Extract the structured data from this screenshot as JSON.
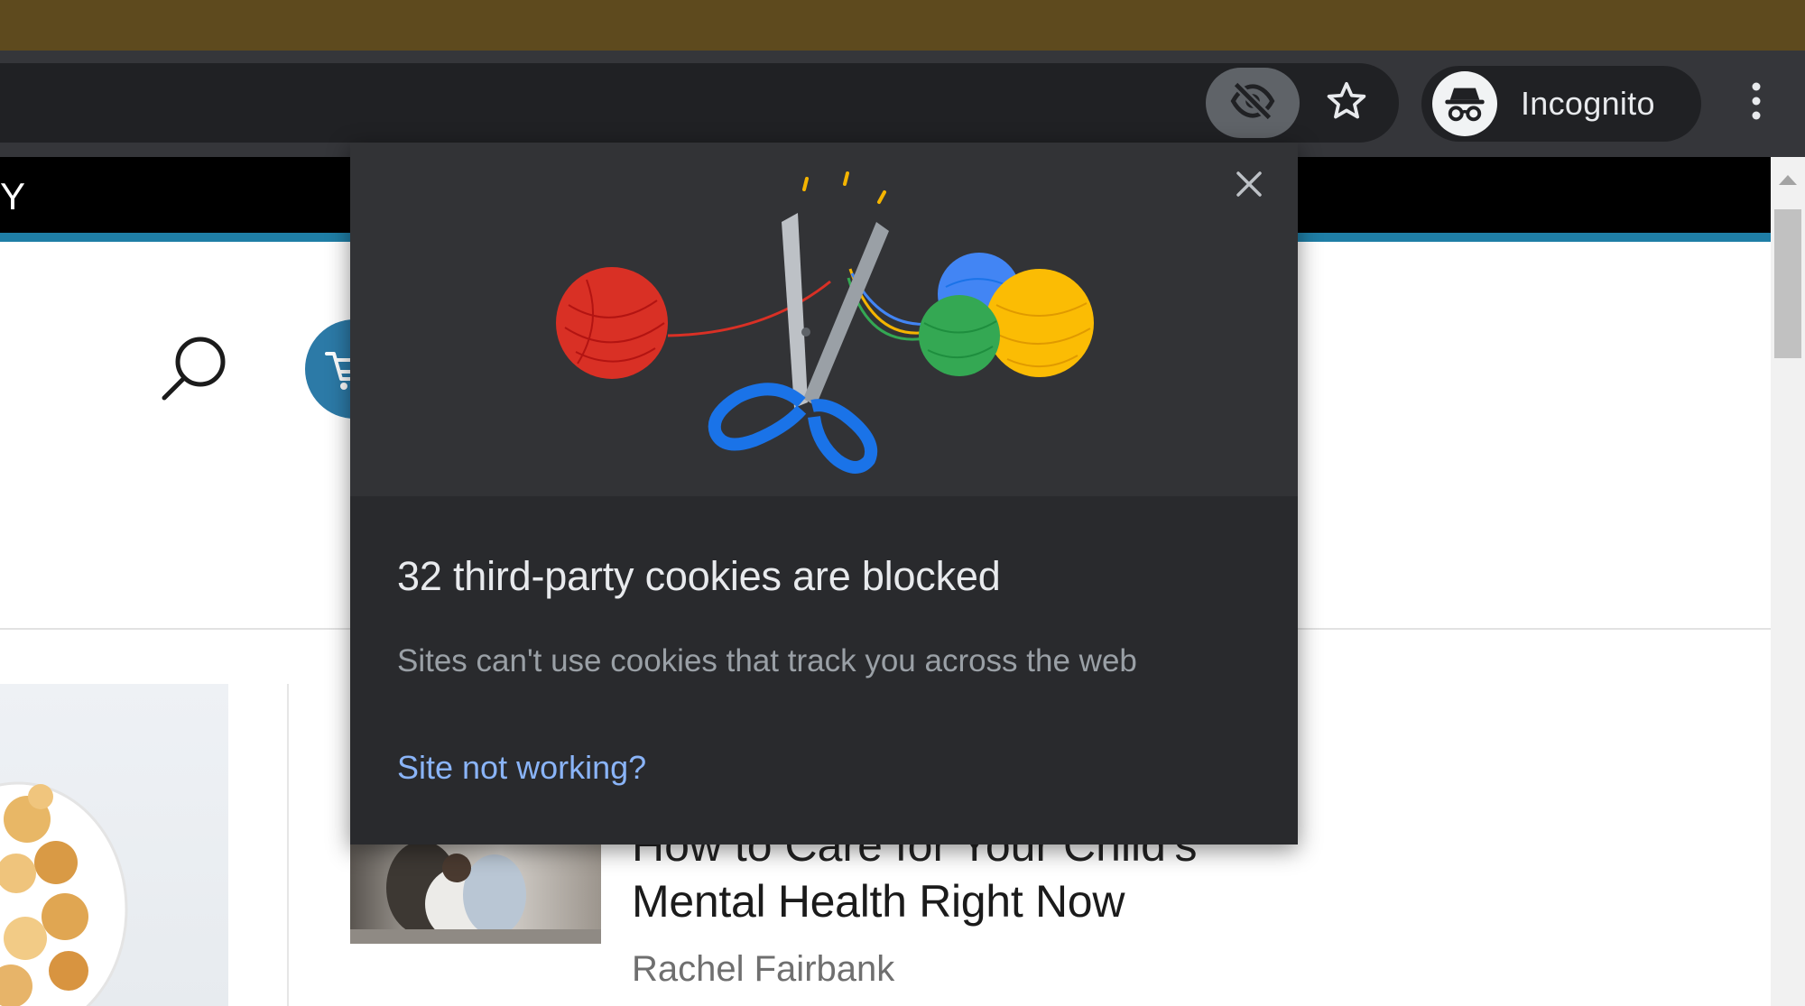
{
  "browser": {
    "profile_label": "Incognito",
    "icons": {
      "third_party_cookies": "eye-off-icon",
      "bookmark": "star-icon",
      "profile": "incognito-icon",
      "menu": "three-dot-menu-icon"
    },
    "colors": {
      "titlebar": "#5e4a1e",
      "toolbar": "#35363a",
      "omnibox": "#202124"
    }
  },
  "page": {
    "nav_fragment": "Y",
    "article": {
      "title_partial": "How to Care for Your Child's",
      "title": "Mental Health Right Now",
      "author": "Rachel Fairbank"
    },
    "icons": {
      "search": "search-icon",
      "cart": "cart-icon"
    },
    "colors": {
      "accent": "#1f7ea6",
      "cart": "#2c7aa7"
    }
  },
  "cookie_popup": {
    "title": "32 third-party cookies are blocked",
    "subtitle": "Sites can't use cookies that track you across the web",
    "link": "Site not working?",
    "close_icon": "close-icon",
    "illustration": "scissors-cutting-yarn-illustration",
    "colors": {
      "background": "#292a2d",
      "illustration_bg": "#323336",
      "link": "#8ab4f8"
    }
  }
}
